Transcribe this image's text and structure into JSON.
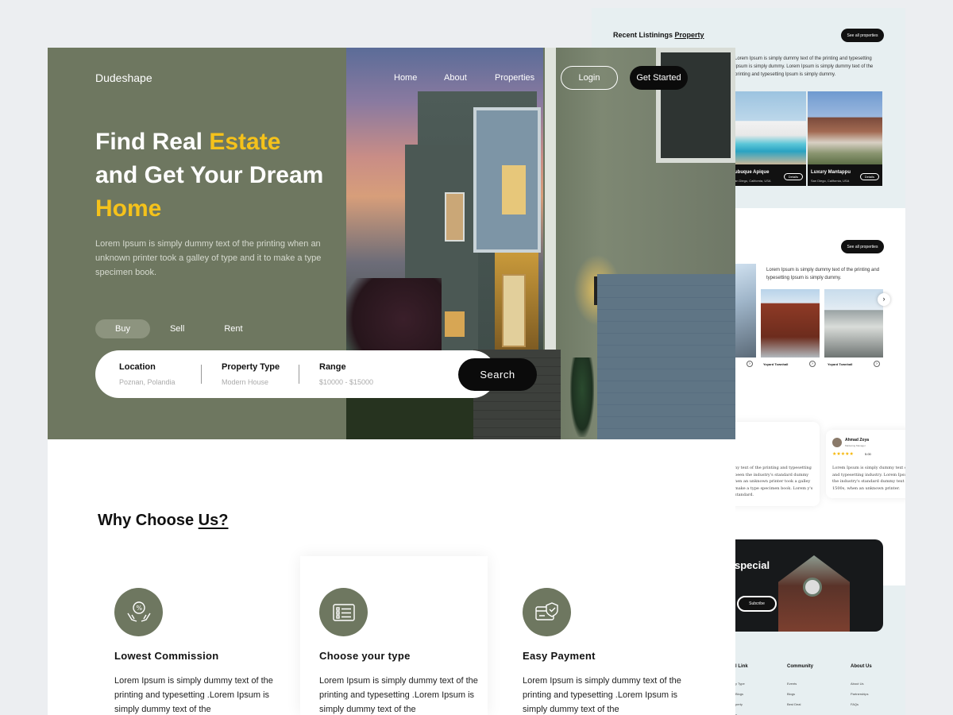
{
  "brand": "Dudeshape",
  "nav": {
    "home": "Home",
    "about": "About",
    "properties": "Properties",
    "login": "Login",
    "get_started": "Get Started"
  },
  "hero": {
    "title_1": "Find Real ",
    "title_accent_1": "Estate",
    "title_2": "and Get Your Dream",
    "title_accent_2": "Home",
    "subtitle": "Lorem Ipsum is simply dummy text of the printing  when an unknown printer took a galley of type and  it to make a type specimen book.",
    "accent_color": "#f5c21b",
    "tabs": [
      {
        "label": "Buy",
        "active": true
      },
      {
        "label": "Sell",
        "active": false
      },
      {
        "label": "Rent",
        "active": false
      }
    ]
  },
  "search": {
    "location": {
      "label": "Location",
      "value": "Poznan, Polandia"
    },
    "property_type": {
      "label": "Property Type",
      "value": "Modern House"
    },
    "range": {
      "label": "Range",
      "value": "$10000 - $15000"
    },
    "button": "Search"
  },
  "why": {
    "title": "Why Choose ",
    "title_underlined": "Us?",
    "features": [
      {
        "icon": "percent-hands-icon",
        "title": "Lowest Commission",
        "desc": "Lorem Ipsum is simply dummy text of the printing and typesetting .Lorem Ipsum is simply dummy text of the"
      },
      {
        "icon": "list-card-icon",
        "title": "Choose your type",
        "desc": "Lorem Ipsum is simply dummy text of the printing and typesetting .Lorem Ipsum is simply dummy text of the"
      },
      {
        "icon": "secure-card-icon",
        "title": "Easy Payment",
        "desc": "Lorem Ipsum is simply dummy text of the printing and typesetting .Lorem Ipsum is simply dummy text of the"
      }
    ]
  },
  "back_page": {
    "recent_title": "Recent Listinings ",
    "recent_title_link": "Property",
    "see_all": "See all properties",
    "recent_para": "Lorem Ipsum is simply dummy text of the printing and typesetting Ipsum is simply dummy. Lorem Ipsum is simply dummy text of the printing and typesetting Ipsum is simply dummy.",
    "listings": [
      {
        "name": "ubuque Apique",
        "location": "an Diego, California, USA",
        "details": "Details"
      },
      {
        "name": "Luxury Mantappu",
        "location": "San Diego, California, USA",
        "details": "Details"
      }
    ],
    "see_all_2": "See all properties",
    "section2_para": "Lorem Ipsum is simply dummy text of the printing and typesetting Ipsum is simply dummy.",
    "buildings": [
      {
        "label": "Yoyard Townhall"
      },
      {
        "label": "Yoyard Townhall"
      }
    ],
    "review_left_text": "ny text of the printing and typesetting been the industry's standard dummy hen an unknown printer took a galley make a type specimen book. Lorem y's standard.",
    "reviewer_name": "Ahmad Zoya",
    "reviewer_role": "Marketing Manager",
    "rating": "5.00",
    "review_right_text": "Lorem Ipsum is simply dummy text o and typesetting industry. Lorem Ipsu the industry's standard dummy text o 1500s, when an unknown printer.",
    "special_title": "special",
    "subscribe": "Subcribe",
    "footer": {
      "col1_title": "l Link",
      "col1_links": [
        "y Type",
        "Blogs",
        "perty",
        "y"
      ],
      "col2_title": "Community",
      "col2_links": [
        "Events",
        "Blogs",
        "Best Deal"
      ],
      "col3_title": "About Us",
      "col3_links": [
        "About Us",
        "Partnerships",
        "FAQs"
      ]
    }
  }
}
